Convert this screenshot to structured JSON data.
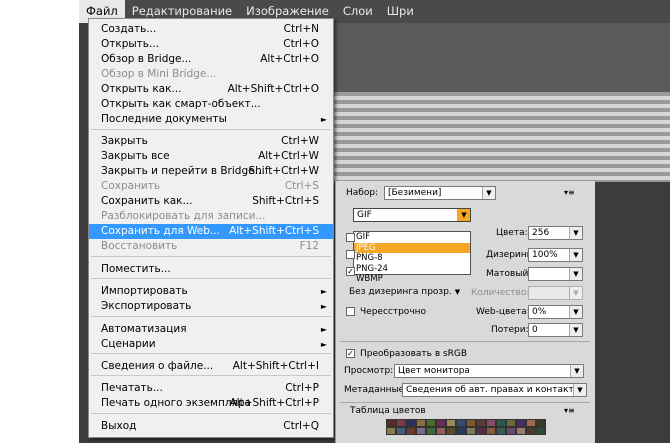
{
  "menubar": {
    "items": [
      "Файл",
      "Редактирование",
      "Изображение",
      "Слои",
      "Шри"
    ]
  },
  "file_menu": {
    "items": [
      {
        "label": "Создать...",
        "shortcut": "Ctrl+N"
      },
      {
        "label": "Открыть...",
        "shortcut": "Ctrl+O"
      },
      {
        "label": "Обзор в Bridge...",
        "shortcut": "Alt+Ctrl+O"
      },
      {
        "label": "Обзор в Mini Bridge...",
        "shortcut": "",
        "disabled": true
      },
      {
        "label": "Открыть как...",
        "shortcut": "Alt+Shift+Ctrl+O"
      },
      {
        "label": "Открыть как смарт-объект...",
        "shortcut": ""
      },
      {
        "label": "Последние документы",
        "shortcut": "",
        "submenu": true
      },
      {
        "label": "Закрыть",
        "shortcut": "Ctrl+W"
      },
      {
        "label": "Закрыть все",
        "shortcut": "Alt+Ctrl+W"
      },
      {
        "label": "Закрыть и перейти в Bridge...",
        "shortcut": "Shift+Ctrl+W"
      },
      {
        "label": "Сохранить",
        "shortcut": "Ctrl+S",
        "disabled": true
      },
      {
        "label": "Сохранить как...",
        "shortcut": "Shift+Ctrl+S"
      },
      {
        "label": "Разблокировать для записи...",
        "shortcut": "",
        "disabled": true
      },
      {
        "label": "Сохранить для Web...",
        "shortcut": "Alt+Shift+Ctrl+S",
        "highlighted": true
      },
      {
        "label": "Восстановить",
        "shortcut": "F12",
        "disabled": true
      },
      {
        "label": "Поместить...",
        "shortcut": ""
      },
      {
        "label": "Импортировать",
        "shortcut": "",
        "submenu": true
      },
      {
        "label": "Экспортировать",
        "shortcut": "",
        "submenu": true
      },
      {
        "label": "Автоматизация",
        "shortcut": "",
        "submenu": true
      },
      {
        "label": "Сценарии",
        "shortcut": "",
        "submenu": true
      },
      {
        "label": "Сведения о файле...",
        "shortcut": "Alt+Shift+Ctrl+I"
      },
      {
        "label": "Печатать...",
        "shortcut": "Ctrl+P"
      },
      {
        "label": "Печать одного экземпляра",
        "shortcut": "Alt+Shift+Ctrl+P"
      },
      {
        "label": "Выход",
        "shortcut": "Ctrl+Q"
      }
    ]
  },
  "save_for_web": {
    "preset_label": "Набор:",
    "preset_value": "[Безимени]",
    "format_value": "GIF",
    "format_options": [
      "GIF",
      "JPEG",
      "PNG-8",
      "PNG-24",
      "WBMP"
    ],
    "colors_label": "Цвета:",
    "colors_value": "256",
    "dither_label": "Дизеринг:",
    "dither_value": "100%",
    "matte_label": "Матовый:",
    "dither_algo_value": "Без дизеринга прозр...",
    "amount_label": "Количество:",
    "interlaced_label": "Чересстрочно",
    "web_snap_label": "Web-цвета:",
    "web_snap_value": "0%",
    "lossy_label": "Потери:",
    "lossy_value": "0",
    "convert_srgb_label": "Преобразовать в sRGB",
    "preview_label": "Просмотр:",
    "preview_value": "Цвет монитора",
    "metadata_label": "Метаданные:",
    "metadata_value": "Сведения об авт. правах и контакты",
    "color_table_label": "Таблица цветов",
    "palette_colors": [
      "#5b2a2a",
      "#7a3b4a",
      "#2d2d5e",
      "#8e6b3a",
      "#4a6b2a",
      "#6a2a5a",
      "#9a8a5a",
      "#3a4a6a",
      "#7a5a2a",
      "#5a3a3a",
      "#8a4a6a",
      "#2a5a4a",
      "#6a6a3a",
      "#4a2a6a",
      "#9a6a4a",
      "#3a3a2a",
      "#8a7a4a",
      "#4a5a7a",
      "#6a3a2a",
      "#7a6a8a",
      "#3a6a3a",
      "#9a5a5a",
      "#5a4a2a",
      "#2a3a5a",
      "#7a7a5a",
      "#5a2a4a",
      "#8a5a3a",
      "#3a5a5a",
      "#6a4a6a",
      "#9a7a6a",
      "#4a3a2a",
      "#2a4a3a"
    ]
  }
}
